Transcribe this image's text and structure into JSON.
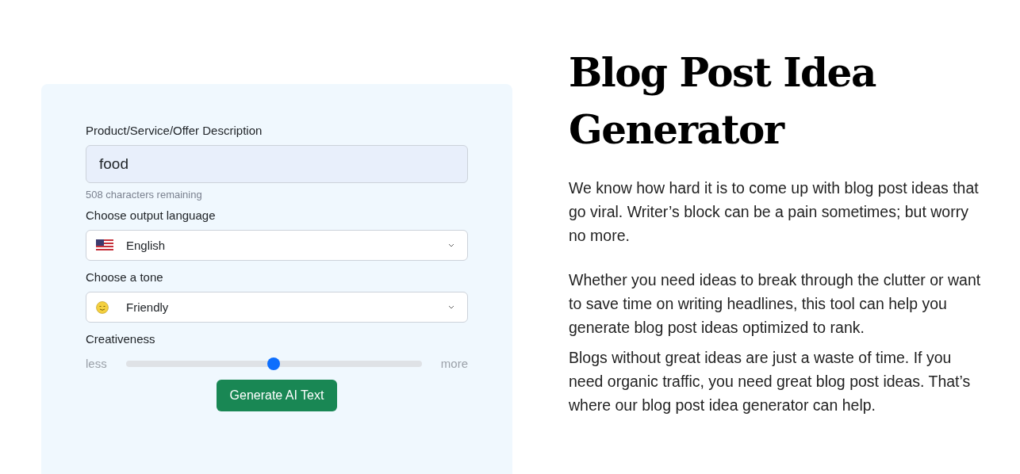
{
  "form": {
    "description": {
      "label": "Product/Service/Offer Description",
      "value": "food",
      "counter": "508 characters remaining"
    },
    "language": {
      "label": "Choose output language",
      "value": "English"
    },
    "tone": {
      "label": "Choose a tone",
      "value": "Friendly"
    },
    "creativeness": {
      "label": "Creativeness",
      "min_label": "less",
      "max_label": "more",
      "level": 0.5
    },
    "submit": "Generate AI Text"
  },
  "article": {
    "title": "Blog Post Idea Generator",
    "paragraphs": [
      "We know how hard it is to come up with blog post ideas that go viral. Writer’s block can be a pain sometimes; but worry no more.",
      "Whether you need ideas to break through the clutter or want to save time on writing headlines, this tool can help you generate blog post ideas optimized to rank.",
      "Blogs without great ideas are just a waste of time. If you need organic traffic, you need great blog post ideas. That’s where our blog post idea generator can help."
    ]
  }
}
